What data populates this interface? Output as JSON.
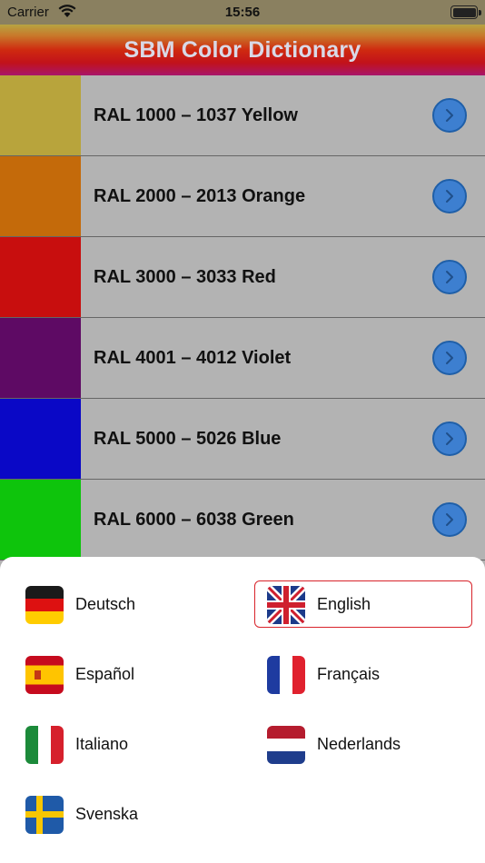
{
  "status_bar": {
    "carrier": "Carrier",
    "time": "15:56"
  },
  "title": "SBM Color Dictionary",
  "colors": [
    {
      "label": "RAL 1000 – 1037 Yellow",
      "color": "#b8a43c"
    },
    {
      "label": "RAL 2000 – 2013 Orange",
      "color": "#c46a0a"
    },
    {
      "label": "RAL 3000 – 3033 Red",
      "color": "#c80e0e"
    },
    {
      "label": "RAL 4001 – 4012 Violet",
      "color": "#5e0a64"
    },
    {
      "label": "RAL 5000 – 5026 Blue",
      "color": "#0a08c6"
    },
    {
      "label": "RAL 6000 – 6038 Green",
      "color": "#0ec40c"
    }
  ],
  "languages": [
    {
      "name": "Deutsch",
      "flag": "germany-flag-icon"
    },
    {
      "name": "English",
      "flag": "uk-flag-icon",
      "selected": true
    },
    {
      "name": "Español",
      "flag": "spain-flag-icon"
    },
    {
      "name": "Français",
      "flag": "france-flag-icon"
    },
    {
      "name": "Italiano",
      "flag": "italy-flag-icon"
    },
    {
      "name": "Nederlands",
      "flag": "netherlands-flag-icon"
    },
    {
      "name": "Svenska",
      "flag": "sweden-flag-icon"
    }
  ],
  "accent": {
    "chevron": "#3d7fd0",
    "selected_border": "#d8232a"
  }
}
